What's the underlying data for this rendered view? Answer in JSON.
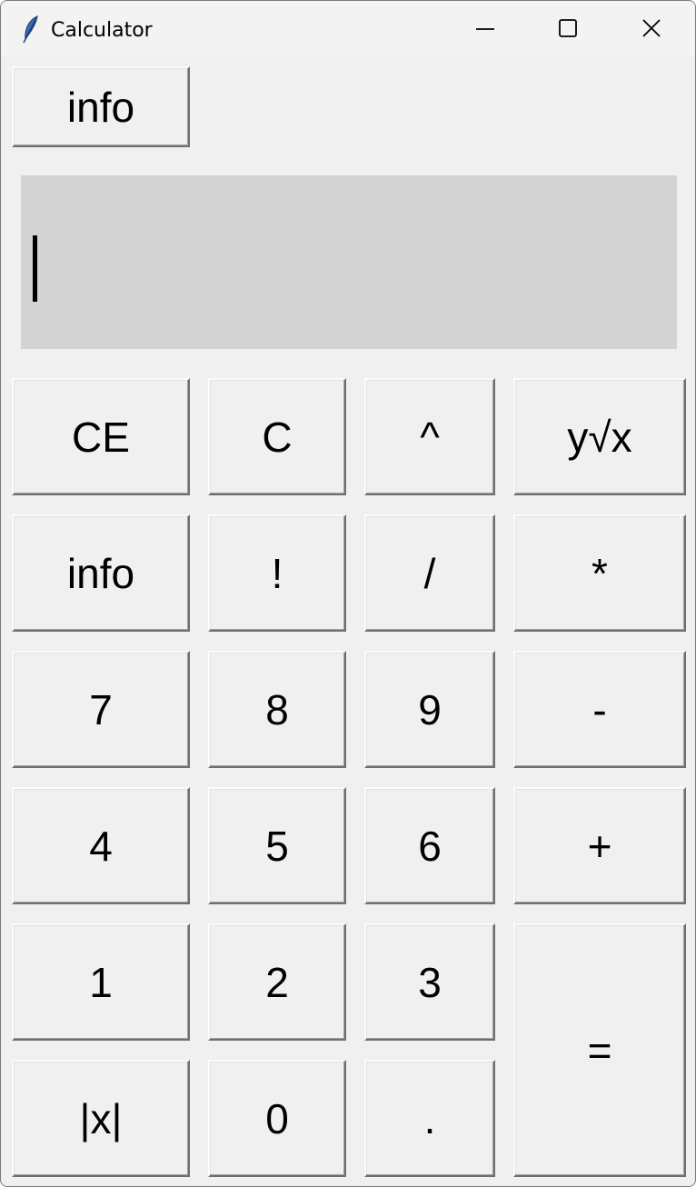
{
  "window": {
    "title": "Calculator",
    "icon": "feather-icon",
    "controls": [
      "minimize-icon",
      "maximize-icon",
      "close-icon"
    ]
  },
  "top_info_button": {
    "label": "info"
  },
  "display": {
    "value": ""
  },
  "keys": {
    "ce": "CE",
    "c": "C",
    "power": "^",
    "root": "y√x",
    "info": "info",
    "factorial": "!",
    "divide": "/",
    "multiply": "*",
    "seven": "7",
    "eight": "8",
    "nine": "9",
    "minus": "-",
    "four": "4",
    "five": "5",
    "six": "6",
    "plus": "+",
    "one": "1",
    "two": "2",
    "three": "3",
    "equals": "=",
    "abs": "|x|",
    "zero": "0",
    "dot": "."
  },
  "colors": {
    "window_bg": "#f0f0f0",
    "display_bg": "#d3d3d3"
  }
}
